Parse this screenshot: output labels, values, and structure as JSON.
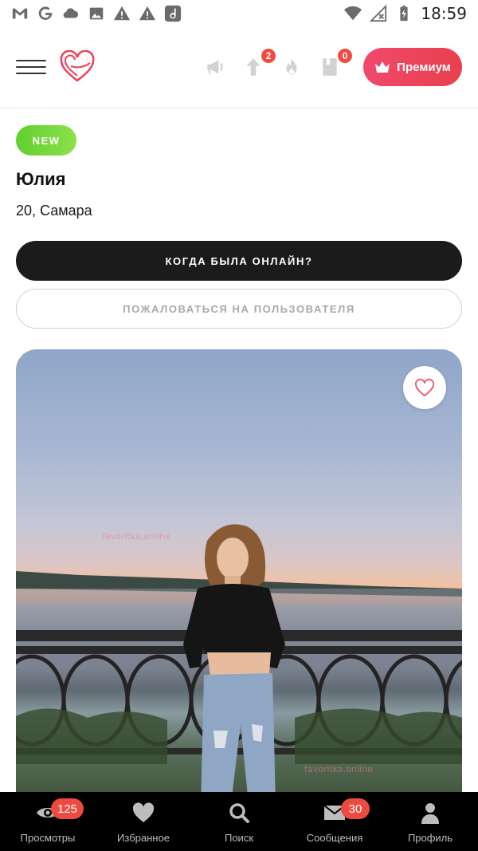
{
  "status_bar": {
    "time": "18:59",
    "left_icons": [
      "gmail-icon",
      "google-icon",
      "cloud-icon",
      "image-icon",
      "warning-icon",
      "warning-icon",
      "d-app-icon"
    ],
    "right_icons": [
      "wifi-icon",
      "no-signal-icon",
      "battery-charging-icon"
    ]
  },
  "header": {
    "menu_icon": "hamburger-icon",
    "logo_icon": "heart-logo-icon",
    "actions": [
      {
        "icon": "megaphone-icon",
        "badge": ""
      },
      {
        "icon": "arrow-up-icon",
        "badge": "2"
      },
      {
        "icon": "fire-icon",
        "badge": ""
      },
      {
        "icon": "book-icon",
        "badge": "0"
      }
    ],
    "premium_label": "Премиум",
    "premium_icon": "crown-icon",
    "colors": {
      "premium": "#ea3f4e",
      "badge": "#f14a3f"
    }
  },
  "profile": {
    "new_badge": "NEW",
    "name": "Юлия",
    "age_location": "20, Самара",
    "online_button": "КОГДА БЫЛА ОНЛАЙН?",
    "report_button": "ПОЖАЛОВАТЬСЯ НА ПОЛЬЗОВАТЕЛЯ",
    "favorite_icon": "heart-outline-icon",
    "watermark": "favoritka.online",
    "colors": {
      "new_badge": "#6fd63a",
      "heart": "#e8556b"
    }
  },
  "bottom_nav": {
    "items": [
      {
        "label": "Просмотры",
        "icon": "eye-icon",
        "badge": "125"
      },
      {
        "label": "Избранное",
        "icon": "heart-icon",
        "badge": ""
      },
      {
        "label": "Поиск",
        "icon": "search-icon",
        "badge": ""
      },
      {
        "label": "Сообщения",
        "icon": "envelope-icon",
        "badge": "30"
      },
      {
        "label": "Профиль",
        "icon": "person-icon",
        "badge": ""
      }
    ]
  }
}
